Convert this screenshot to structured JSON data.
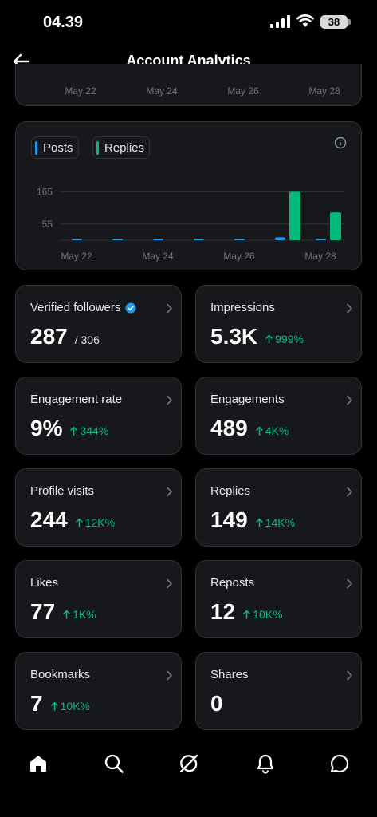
{
  "status_bar": {
    "time": "04.39",
    "battery": "38"
  },
  "header": {
    "title": "Account Analytics"
  },
  "prev_chart": {
    "x_labels": [
      "May 22",
      "May 24",
      "May 26",
      "May 28"
    ]
  },
  "chart_data": {
    "type": "bar",
    "legend": [
      "Posts",
      "Replies"
    ],
    "x_tick_labels": [
      "May 22",
      "May 24",
      "May 26",
      "May 28"
    ],
    "y_tick_labels": [
      "165",
      "55"
    ],
    "categories": [
      "May 22",
      "May 23",
      "May 24",
      "May 25",
      "May 26",
      "May 27",
      "May 28"
    ],
    "series": [
      {
        "name": "Posts",
        "color": "#1d9bf0",
        "values": [
          1,
          1,
          0,
          1,
          1,
          10,
          4
        ]
      },
      {
        "name": "Replies",
        "color": "#00ba7c",
        "values": [
          0,
          0,
          0,
          0,
          0,
          165,
          95
        ]
      }
    ],
    "ylim": [
      0,
      185
    ],
    "grid": true
  },
  "metrics": [
    {
      "label": "Verified followers",
      "value": "287",
      "sub": "/ 306",
      "change": "",
      "verified": true
    },
    {
      "label": "Impressions",
      "value": "5.3K",
      "sub": "",
      "change": "999%"
    },
    {
      "label": "Engagement rate",
      "value": "9%",
      "sub": "",
      "change": "344%"
    },
    {
      "label": "Engagements",
      "value": "489",
      "sub": "",
      "change": "4K%"
    },
    {
      "label": "Profile visits",
      "value": "244",
      "sub": "",
      "change": "12K%"
    },
    {
      "label": "Replies",
      "value": "149",
      "sub": "",
      "change": "14K%"
    },
    {
      "label": "Likes",
      "value": "77",
      "sub": "",
      "change": "1K%"
    },
    {
      "label": "Reposts",
      "value": "12",
      "sub": "",
      "change": "10K%"
    },
    {
      "label": "Bookmarks",
      "value": "7",
      "sub": "",
      "change": "10K%"
    },
    {
      "label": "Shares",
      "value": "0",
      "sub": "",
      "change": ""
    }
  ],
  "bottom_nav": [
    "home-icon",
    "search-icon",
    "grok-icon",
    "notifications-icon",
    "messages-icon"
  ],
  "colors": {
    "accent_blue": "#1d9bf0",
    "accent_green": "#00ba7c",
    "card_bg": "#16181c",
    "border": "#2f3336"
  }
}
